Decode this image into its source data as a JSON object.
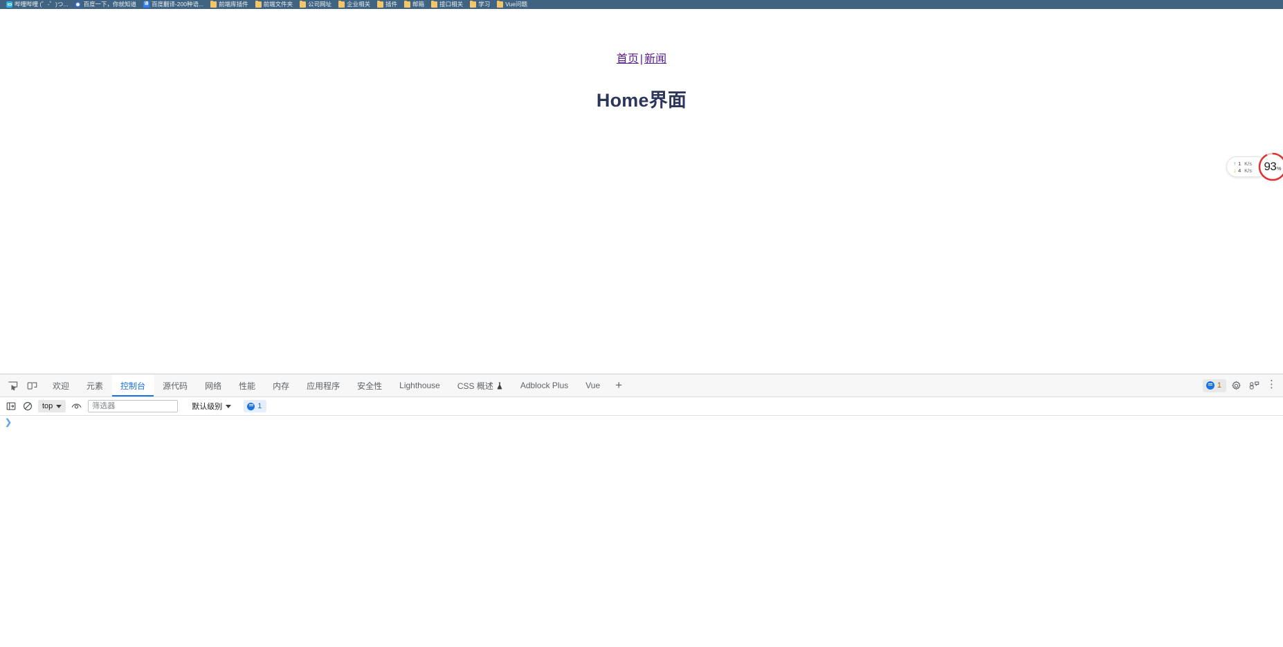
{
  "bookmarks": {
    "items": [
      {
        "label": "哔哩哔哩 (゜-゜)つ...",
        "icon": "bilibili-icon",
        "icon_kind": "bili"
      },
      {
        "label": "百度一下，你就知道",
        "icon": "baidu-icon",
        "icon_kind": "baidu"
      },
      {
        "label": "百度翻译-200种语...",
        "icon": "baidu-fanyi-icon",
        "icon_kind": "fanyi",
        "icon_text": "译"
      },
      {
        "label": "前端库插件",
        "icon": "folder-icon",
        "icon_kind": "folder"
      },
      {
        "label": "前端文件夹",
        "icon": "folder-icon",
        "icon_kind": "folder"
      },
      {
        "label": "公司网址",
        "icon": "folder-icon",
        "icon_kind": "folder"
      },
      {
        "label": "企业相关",
        "icon": "folder-icon",
        "icon_kind": "folder"
      },
      {
        "label": "插件",
        "icon": "folder-icon",
        "icon_kind": "folder"
      },
      {
        "label": "邮箱",
        "icon": "folder-icon",
        "icon_kind": "folder"
      },
      {
        "label": "接口相关",
        "icon": "folder-icon",
        "icon_kind": "folder"
      },
      {
        "label": "学习",
        "icon": "folder-icon",
        "icon_kind": "folder"
      },
      {
        "label": "Vue问题",
        "icon": "folder-icon",
        "icon_kind": "folder"
      }
    ]
  },
  "page": {
    "nav": {
      "home_link": "首页",
      "separator": "|",
      "news_link": "新闻"
    },
    "title": "Home界面",
    "link_color": "#551a8b",
    "title_color": "#2c3659"
  },
  "perf_widget": {
    "upload": {
      "arrow": "↑",
      "value": "1",
      "unit": "K/s",
      "color": "#3ab54a"
    },
    "download": {
      "arrow": "↓",
      "value": "4",
      "unit": "K/s",
      "color": "#f0a027"
    },
    "cpu_percent": "93",
    "percent_symbol": "%",
    "gauge_color": "#e03131"
  },
  "devtools": {
    "tool_icons": [
      {
        "name": "inspect-element-icon"
      },
      {
        "name": "device-toolbar-icon"
      }
    ],
    "tabs": [
      {
        "label": "欢迎",
        "active": false
      },
      {
        "label": "元素",
        "active": false
      },
      {
        "label": "控制台",
        "active": true
      },
      {
        "label": "源代码",
        "active": false
      },
      {
        "label": "网络",
        "active": false
      },
      {
        "label": "性能",
        "active": false
      },
      {
        "label": "内存",
        "active": false
      },
      {
        "label": "应用程序",
        "active": false
      },
      {
        "label": "安全性",
        "active": false
      },
      {
        "label": "Lighthouse",
        "active": false
      },
      {
        "label": "CSS 概述",
        "active": false,
        "experimental": true
      },
      {
        "label": "Adblock Plus",
        "active": false
      },
      {
        "label": "Vue",
        "active": false
      }
    ],
    "add_tab_label": "+",
    "right": {
      "message_count": "1",
      "settings_icon": "gear-icon",
      "customize_icon": "dock-side-icon",
      "more_icon": "more-options-icon",
      "more_label": "⋮"
    },
    "console_toolbar": {
      "sidebar_toggle_icon": "console-sidebar-icon",
      "clear_icon": "clear-console-icon",
      "context_selector": "top",
      "live_expression_icon": "eye-icon",
      "filter_placeholder": "筛选器",
      "filter_value": "",
      "levels_selector": "默认级别",
      "issues_count": "1"
    },
    "console_body": {
      "prompt_chevron": "❯",
      "prompt_value": "",
      "active_tab_label": "控制台"
    }
  },
  "colors": {
    "bookmark_bar_bg": "#3f6381",
    "devtools_tabbar_bg": "#f7f7f7",
    "accent_blue": "#1a73e8"
  }
}
